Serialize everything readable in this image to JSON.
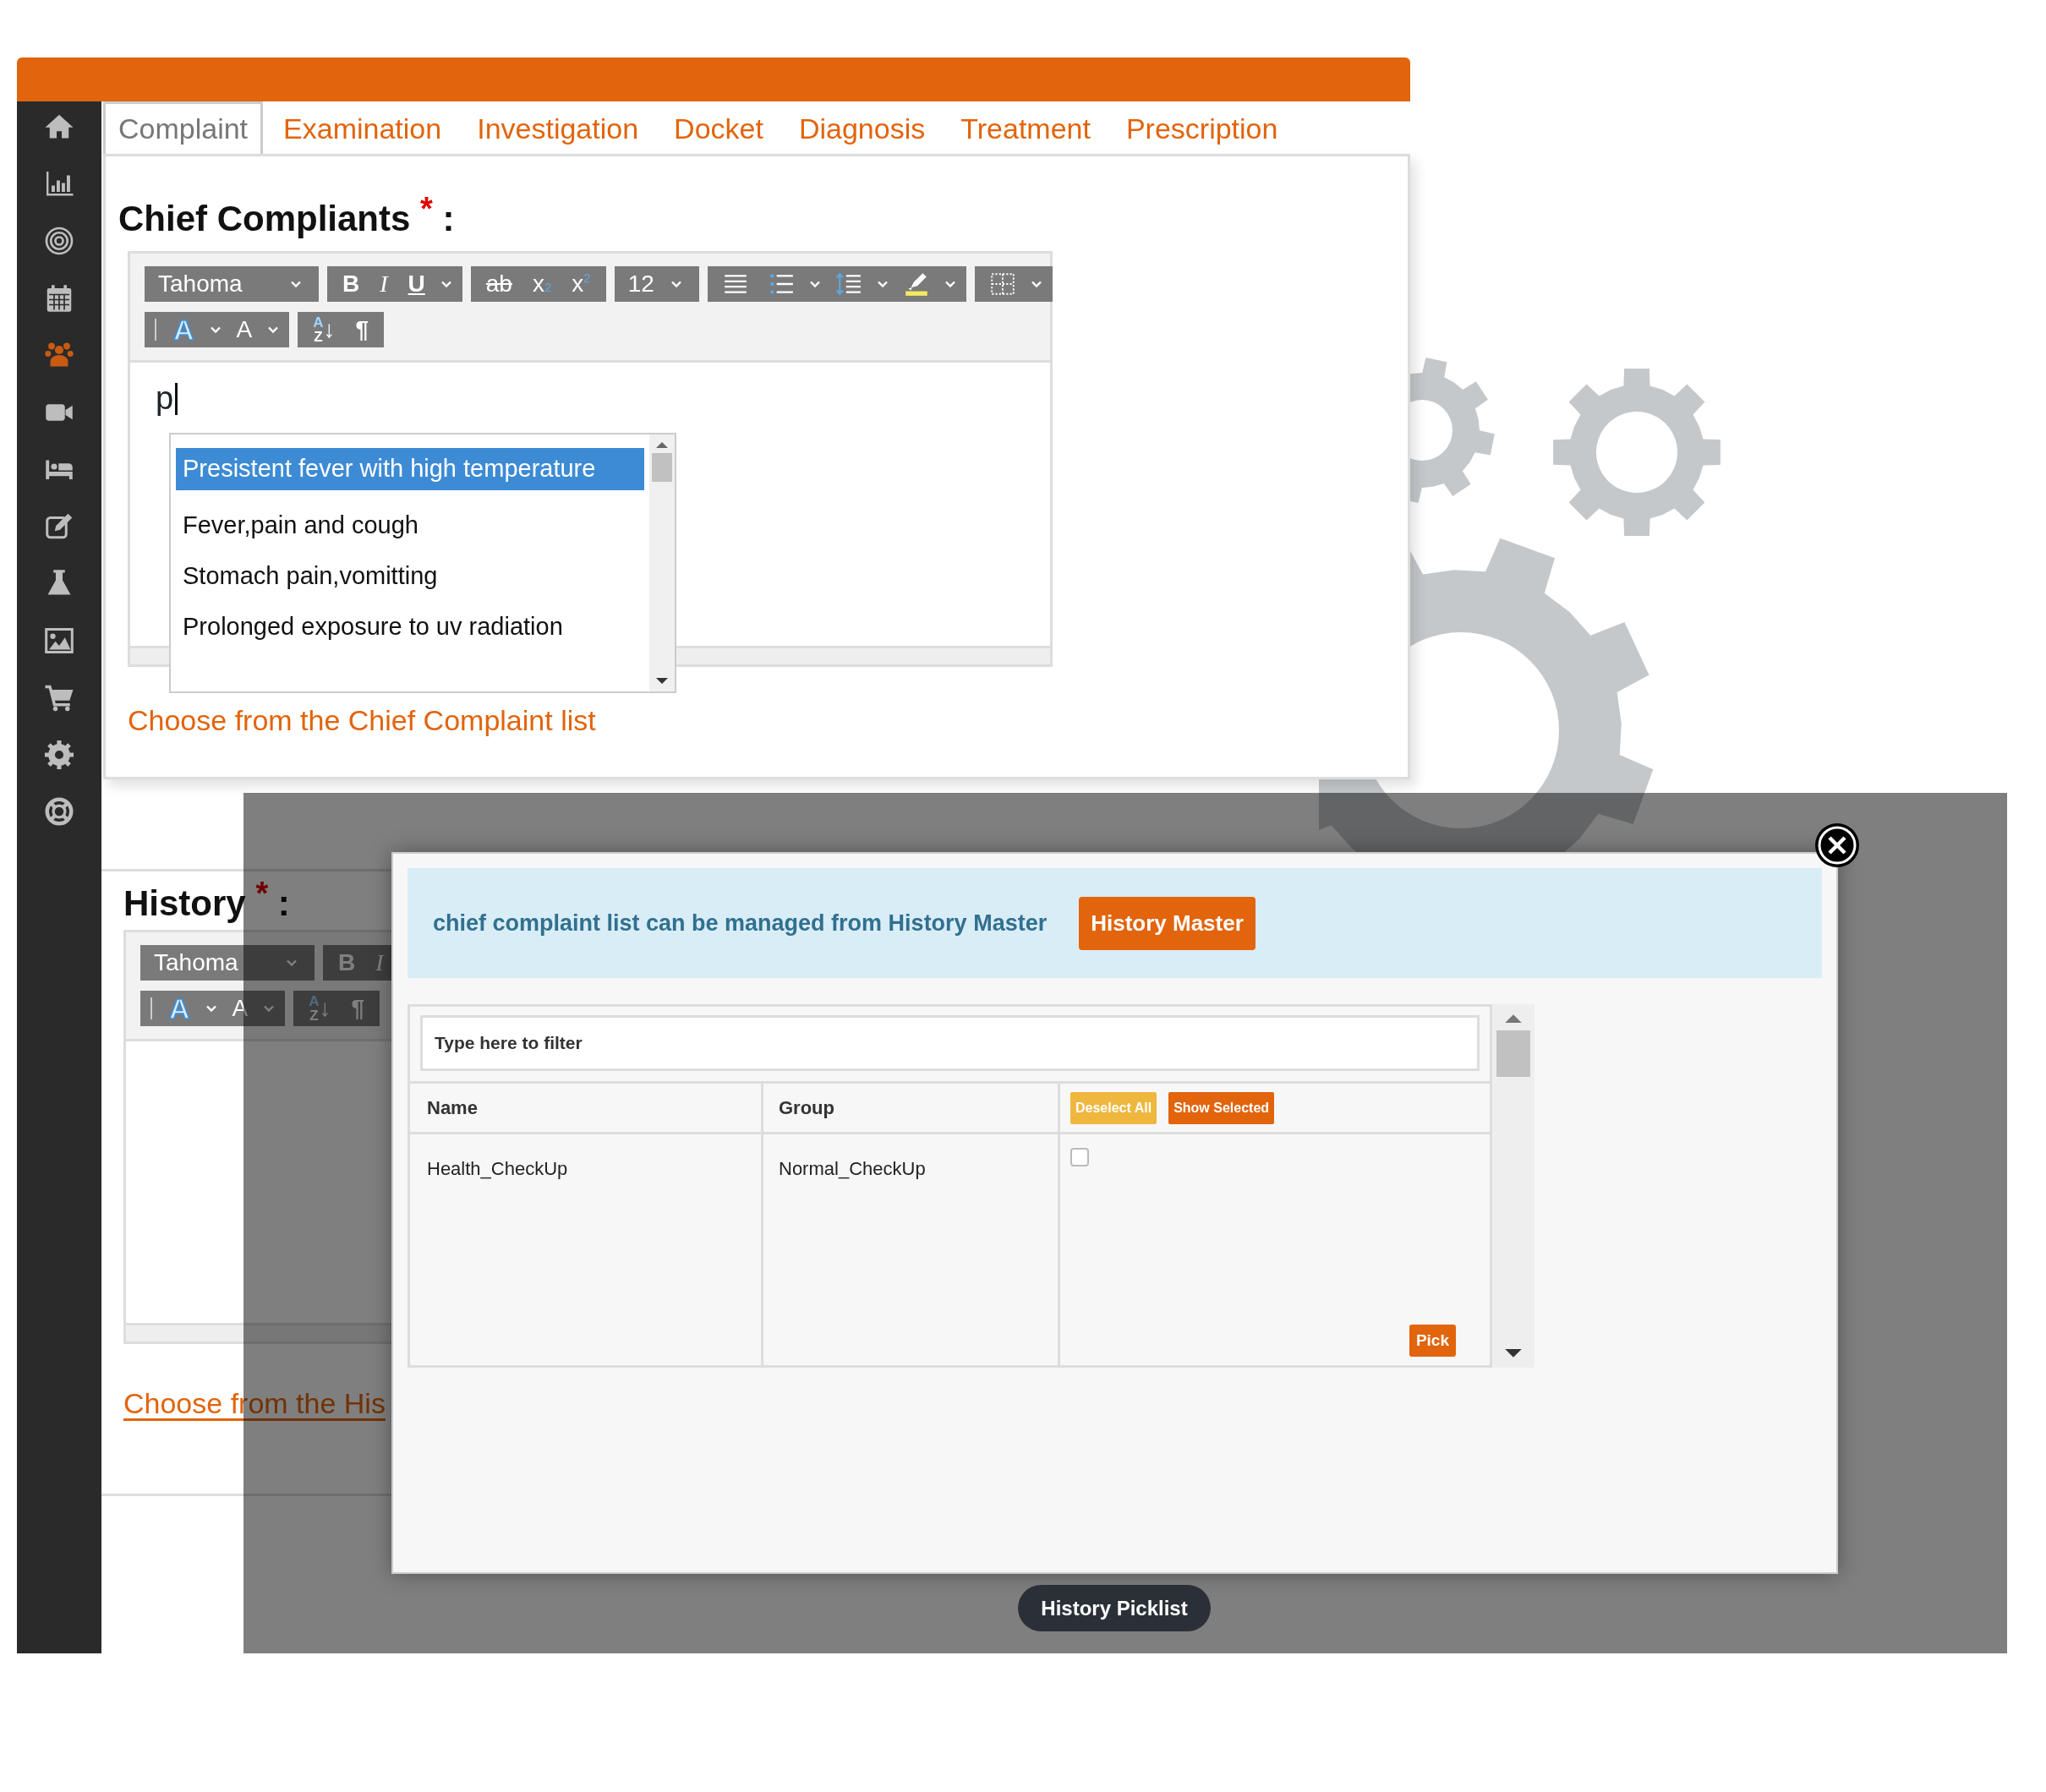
{
  "tabs": [
    {
      "label": "Complaint",
      "selected": true
    },
    {
      "label": "Examination",
      "selected": false
    },
    {
      "label": "Investigation",
      "selected": false
    },
    {
      "label": "Docket",
      "selected": false
    },
    {
      "label": "Diagnosis",
      "selected": false
    },
    {
      "label": "Treatment",
      "selected": false
    },
    {
      "label": "Prescription",
      "selected": false
    }
  ],
  "sidebar": {
    "items": [
      {
        "selected": false
      },
      {
        "selected": false
      },
      {
        "selected": false
      },
      {
        "selected": false
      },
      {
        "selected": true
      },
      {
        "selected": false
      },
      {
        "selected": false
      },
      {
        "selected": false
      },
      {
        "selected": false
      },
      {
        "selected": false
      },
      {
        "selected": false
      },
      {
        "selected": false
      },
      {
        "selected": false
      }
    ]
  },
  "chief_complaints": {
    "title": "Chief Compliants $^{*}$ :",
    "toolbar": [
      [
        [
          {
            "kind": "font-select",
            "label": "Tahoma"
          }
        ],
        [
          {
            "kind": "bold",
            "label": "B"
          },
          {
            "kind": "italic",
            "label": "I"
          },
          {
            "kind": "underline",
            "label": "U"
          },
          {
            "kind": "caret"
          }
        ],
        [
          {
            "kind": "strike",
            "label": "ab"
          },
          {
            "kind": "subscript",
            "label": "x$_{2}$"
          },
          {
            "kind": "superscript",
            "label": "x$^{2}$"
          }
        ],
        [
          {
            "kind": "size-select",
            "label": "12"
          }
        ],
        [
          {
            "kind": "justify"
          },
          {
            "kind": "numbered"
          },
          {
            "kind": "caret"
          },
          {
            "kind": "spacing"
          },
          {
            "kind": "caret"
          },
          {
            "kind": "highlight"
          },
          {
            "kind": "caret"
          }
        ],
        [
          {
            "kind": "table"
          },
          {
            "kind": "caret"
          }
        ]
      ],
      [
        [
          {
            "kind": "bar"
          },
          {
            "kind": "fontcolor",
            "label": "A"
          },
          {
            "kind": "caret"
          },
          {
            "kind": "fontsize",
            "label": "A"
          },
          {
            "kind": "caret"
          }
        ],
        [
          {
            "kind": "sort",
            "top": "A",
            "bottom": "Z",
            "arrow": "↓"
          },
          {
            "kind": "pilcrow",
            "label": "¶"
          }
        ]
      ]
    ],
    "value": "p",
    "suggestions": [
      {
        "label": "Presistent fever with high temperature",
        "selected": true
      },
      {
        "label": "Fever,pain and cough",
        "selected": false
      },
      {
        "label": "Stomach pain,vomitting",
        "selected": false
      },
      {
        "label": "Prolonged exposure to uv radiation",
        "selected": false
      }
    ],
    "link": "Choose from the Chief Complaint list"
  },
  "history": {
    "title": "History $^{*}$ :",
    "toolbar": [
      [
        [
          {
            "kind": "font-select",
            "label": "Tahoma"
          }
        ],
        [
          {
            "kind": "bold",
            "label": "B"
          },
          {
            "kind": "italic",
            "label": "I"
          }
        ]
      ],
      [
        [
          {
            "kind": "bar"
          },
          {
            "kind": "fontcolor",
            "label": "A"
          },
          {
            "kind": "caret"
          },
          {
            "kind": "fontsize",
            "label": "A"
          },
          {
            "kind": "caret"
          }
        ],
        [
          {
            "kind": "sort",
            "top": "A",
            "bottom": "Z",
            "arrow": "↓"
          },
          {
            "kind": "pilcrow",
            "label": "¶"
          }
        ]
      ]
    ],
    "link": "Choose from the His"
  },
  "modal": {
    "alert": "chief complaint list can be managed from History Master",
    "alert_button": "History Master",
    "filter": {
      "placeholder": "Type here to filter"
    },
    "columns": [
      "Name",
      "Group"
    ],
    "header_buttons": [
      {
        "label": "Deselect All",
        "color": "#f0b73e"
      },
      {
        "label": "Show Selected",
        "color": "#e2640c"
      }
    ],
    "rows": [
      {
        "name": "Health_CheckUp",
        "group": "Normal_CheckUp",
        "checked": false
      }
    ],
    "pick_button": "Pick"
  },
  "tooltip": "History Picklist"
}
